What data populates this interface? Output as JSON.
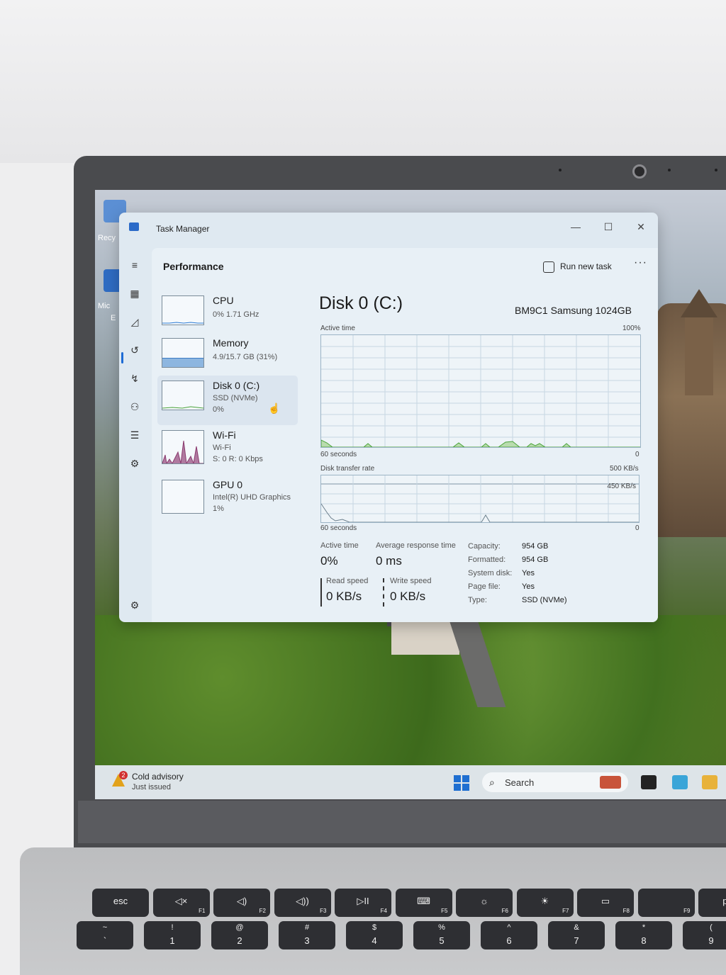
{
  "window": {
    "title": "Task Manager",
    "controls": {
      "minimize": "—",
      "maximize": "☐",
      "close": "✕"
    }
  },
  "nav_rail": {
    "icons": [
      "hamburger-icon",
      "processes-icon",
      "performance-icon",
      "app-history-icon",
      "startup-apps-icon",
      "users-icon",
      "details-icon",
      "services-icon",
      "settings-icon"
    ]
  },
  "header": {
    "title": "Performance",
    "run_new_task": "Run new task",
    "more": "···"
  },
  "sidebar": {
    "items": [
      {
        "name": "CPU",
        "sub1": "0% 1.71 GHz",
        "sub2": ""
      },
      {
        "name": "Memory",
        "sub1": "4.9/15.7 GB (31%)",
        "sub2": ""
      },
      {
        "name": "Disk 0 (C:)",
        "sub1": "SSD (NVMe)",
        "sub2": "0%"
      },
      {
        "name": "Wi-Fi",
        "sub1": "Wi-Fi",
        "sub2": "S: 0 R: 0 Kbps"
      },
      {
        "name": "GPU 0",
        "sub1": "Intel(R) UHD Graphics",
        "sub2": "1%"
      }
    ],
    "memory_fill_fraction": 0.31
  },
  "detail": {
    "title": "Disk 0 (C:)",
    "model": "BM9C1 Samsung 1024GB",
    "active_graph": {
      "label": "Active time",
      "max": "100%",
      "x_label": "60 seconds",
      "min": "0"
    },
    "transfer_graph": {
      "label": "Disk transfer rate",
      "max": "500 KB/s",
      "line_label": "450 KB/s",
      "x_label": "60 seconds",
      "min": "0"
    },
    "stats": {
      "active_time": {
        "label": "Active time",
        "value": "0%"
      },
      "avg_response": {
        "label": "Average response time",
        "value": "0 ms"
      },
      "read_speed": {
        "label": "Read speed",
        "value": "0 KB/s"
      },
      "write_speed": {
        "label": "Write speed",
        "value": "0 KB/s"
      }
    },
    "properties": [
      {
        "label": "Capacity:",
        "value": "954 GB"
      },
      {
        "label": "Formatted:",
        "value": "954 GB"
      },
      {
        "label": "System disk:",
        "value": "Yes"
      },
      {
        "label": "Page file:",
        "value": "Yes"
      },
      {
        "label": "Type:",
        "value": "SSD (NVMe)"
      }
    ]
  },
  "desktop": {
    "icons": [
      {
        "label": "Recy"
      },
      {
        "label": "Mic"
      },
      {
        "label": "E"
      }
    ]
  },
  "taskbar": {
    "weather_title": "Cold advisory",
    "weather_sub": "Just issued",
    "weather_badge": "2",
    "search_label": "Search"
  },
  "keyboard": {
    "fn_row": [
      {
        "main": "esc",
        "fn": ""
      },
      {
        "main": "◁×",
        "fn": "F1"
      },
      {
        "main": "◁)",
        "fn": "F2"
      },
      {
        "main": "◁))",
        "fn": "F3"
      },
      {
        "main": "▷II",
        "fn": "F4"
      },
      {
        "main": "⌨",
        "fn": "F5"
      },
      {
        "main": "☼",
        "fn": "F6"
      },
      {
        "main": "☀",
        "fn": "F7"
      },
      {
        "main": "▭",
        "fn": "F8"
      },
      {
        "main": "",
        "fn": "F9"
      },
      {
        "main": "pr",
        "fn": ""
      }
    ],
    "num_row": [
      {
        "top": "~",
        "main": "`"
      },
      {
        "top": "!",
        "main": "1"
      },
      {
        "top": "@",
        "main": "2"
      },
      {
        "top": "#",
        "main": "3"
      },
      {
        "top": "$",
        "main": "4"
      },
      {
        "top": "%",
        "main": "5"
      },
      {
        "top": "^",
        "main": "6"
      },
      {
        "top": "&",
        "main": "7"
      },
      {
        "top": "*",
        "main": "8"
      },
      {
        "top": "(",
        "main": "9"
      }
    ]
  }
}
